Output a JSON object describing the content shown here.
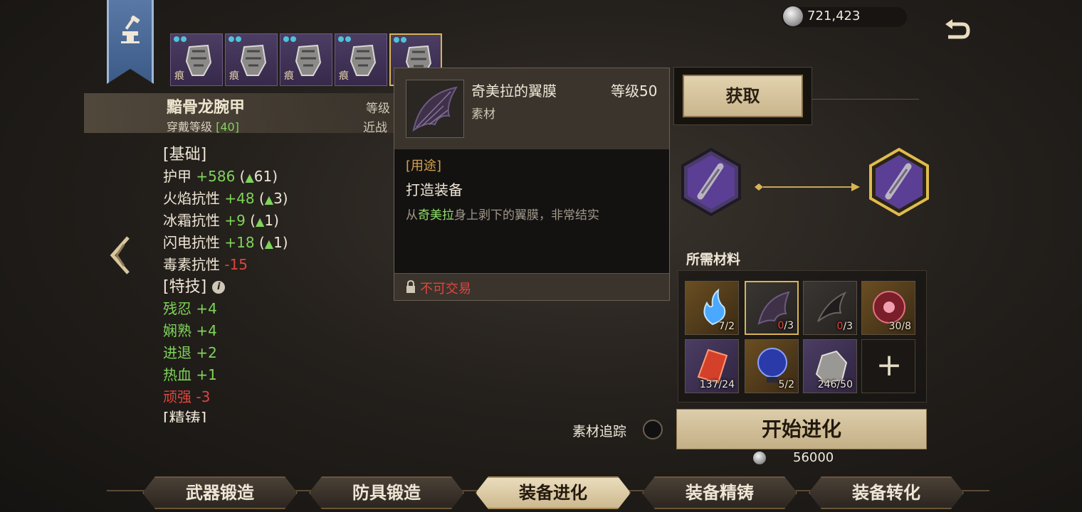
{
  "currency": {
    "amount": "721,423",
    "icon": "silver-coin-icon"
  },
  "equipment_thumbs": [
    {
      "tag": "痕",
      "selected": false
    },
    {
      "tag": "痕",
      "selected": false
    },
    {
      "tag": "痕",
      "selected": false
    },
    {
      "tag": "痕",
      "selected": false
    },
    {
      "tag": "",
      "selected": true
    }
  ],
  "item": {
    "name": "黯骨龙腕甲",
    "wear_level_label": "穿戴等级",
    "wear_level_value": "[40]",
    "level_label_truncated": "等级",
    "melee_truncated": "近战"
  },
  "stats": {
    "base_header": "[基础]",
    "base": [
      {
        "label": "护甲",
        "value": "+586",
        "bonus": "61"
      },
      {
        "label": "火焰抗性",
        "value": "+48",
        "bonus": "3"
      },
      {
        "label": "冰霜抗性",
        "value": "+9",
        "bonus": "1"
      },
      {
        "label": "闪电抗性",
        "value": "+18",
        "bonus": "1"
      },
      {
        "label": "毒素抗性",
        "value": "-15",
        "bonus": null
      }
    ],
    "skills_header": "[特技]",
    "skills": [
      {
        "label": "残忍",
        "value": "+4",
        "negative": false
      },
      {
        "label": "娴熟",
        "value": "+4",
        "negative": false
      },
      {
        "label": "进退",
        "value": "+2",
        "negative": false
      },
      {
        "label": "热血",
        "value": "+1",
        "negative": false
      },
      {
        "label": "顽强",
        "value": "-3",
        "negative": true
      }
    ],
    "next_header_cut": "[精铸]"
  },
  "tooltip": {
    "name": "奇美拉的翼膜",
    "level": "等级50",
    "type": "素材",
    "usage_header": "[用途]",
    "usage": "打造装备",
    "desc_prefix": "从",
    "desc_highlight": "奇美拉",
    "desc_suffix": "身上剥下的翼膜，非常结实",
    "untradable": "不可交易"
  },
  "obtain_button": "获取",
  "materials_title": "所需材料",
  "materials": [
    {
      "name": "blue-flame",
      "have": "7",
      "need": "2",
      "short": false,
      "frame": "gold",
      "selected": false
    },
    {
      "name": "chimera-wing",
      "have": "0",
      "need": "3",
      "short": true,
      "frame": "grey",
      "selected": true
    },
    {
      "name": "dark-claw",
      "have": "0",
      "need": "3",
      "short": true,
      "frame": "grey",
      "selected": false
    },
    {
      "name": "red-orb",
      "have": "30",
      "need": "8",
      "short": false,
      "frame": "gold",
      "selected": false
    },
    {
      "name": "red-crystal",
      "have": "137",
      "need": "24",
      "short": false,
      "frame": "purple",
      "selected": false
    },
    {
      "name": "blue-sphere",
      "have": "5",
      "need": "2",
      "short": false,
      "frame": "gold",
      "selected": false
    },
    {
      "name": "silver-ore",
      "have": "246",
      "need": "50",
      "short": false,
      "frame": "purple",
      "selected": false
    }
  ],
  "add_material": "+",
  "track_label": "素材追踪",
  "start_button": "开始进化",
  "cost": "56000",
  "tabs": [
    {
      "label": "武器锻造",
      "active": false
    },
    {
      "label": "防具锻造",
      "active": false
    },
    {
      "label": "装备进化",
      "active": true
    },
    {
      "label": "装备精铸",
      "active": false
    },
    {
      "label": "装备转化",
      "active": false
    }
  ],
  "colors": {
    "accent_gold": "#d7b454",
    "positive": "#7fd45a",
    "negative": "#e0453d"
  }
}
